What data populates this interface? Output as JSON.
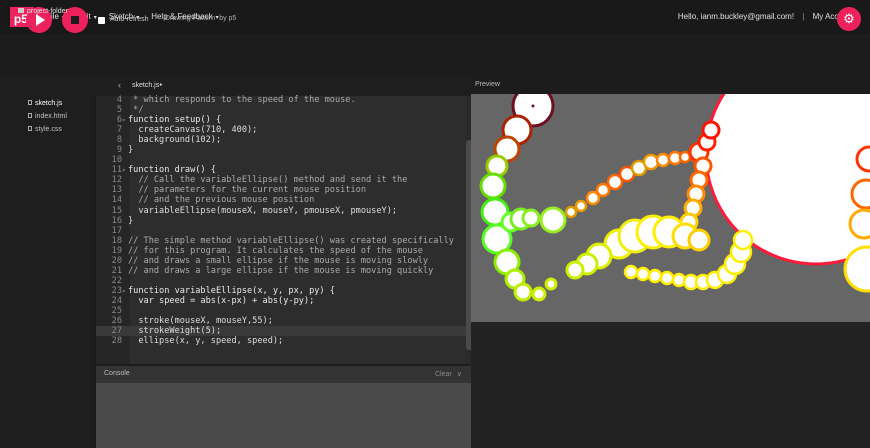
{
  "nav": {
    "logo": "p5",
    "logo_sup": "*",
    "menu": [
      {
        "label": "File"
      },
      {
        "label": "Edit"
      },
      {
        "label": "Sketch"
      },
      {
        "label": "Help & Feedback"
      }
    ],
    "greeting": "Hello, ianm.buckley@gmail.com!",
    "separator": "|",
    "account": "My Account"
  },
  "toolbar": {
    "auto_refresh": "Auto-refresh",
    "sketch_name": "Drawing Pattern",
    "author": "by p5"
  },
  "sidebar": {
    "folder": "project-folder",
    "files": [
      "sketch.js",
      "index.html",
      "style.css"
    ]
  },
  "editor": {
    "tab": "sketch.js",
    "tab_marker": "●",
    "lines": [
      {
        "n": "4",
        "t": " * which responds to the speed of the mouse."
      },
      {
        "n": "5",
        "t": " */"
      },
      {
        "n": "6",
        "t": "function setup() {"
      },
      {
        "n": "7",
        "t": "  createCanvas(710, 400);"
      },
      {
        "n": "8",
        "t": "  background(102);"
      },
      {
        "n": "9",
        "t": "}"
      },
      {
        "n": "10",
        "t": ""
      },
      {
        "n": "11",
        "t": "function draw() {"
      },
      {
        "n": "12",
        "t": "  // Call the variableEllipse() method and send it the"
      },
      {
        "n": "13",
        "t": "  // parameters for the current mouse position"
      },
      {
        "n": "14",
        "t": "  // and the previous mouse position"
      },
      {
        "n": "15",
        "t": "  variableEllipse(mouseX, mouseY, pmouseX, pmouseY);"
      },
      {
        "n": "16",
        "t": "}"
      },
      {
        "n": "17",
        "t": ""
      },
      {
        "n": "18",
        "t": "// The simple method variableEllipse() was created specifically"
      },
      {
        "n": "19",
        "t": "// for this program. It calculates the speed of the mouse"
      },
      {
        "n": "20",
        "t": "// and draws a small ellipse if the mouse is moving slowly"
      },
      {
        "n": "21",
        "t": "// and draws a large ellipse if the mouse is moving quickly"
      },
      {
        "n": "22",
        "t": ""
      },
      {
        "n": "23",
        "t": "function variableEllipse(x, y, px, py) {"
      },
      {
        "n": "24",
        "t": "  var speed = abs(x-px) + abs(y-py);"
      },
      {
        "n": "25",
        "t": ""
      },
      {
        "n": "26",
        "t": "  stroke(mouseX, mouseY,55);"
      },
      {
        "n": "27",
        "t": "  strokeWeight(5);"
      },
      {
        "n": "28",
        "t": "  ellipse(x, y, speed, speed);"
      }
    ]
  },
  "console": {
    "title": "Console",
    "clear": "Clear"
  },
  "preview": {
    "label": "Preview"
  },
  "colors": {
    "accent": "#ed225d",
    "canvas_bg": "#666666",
    "editor_bg": "#2d2d2d"
  }
}
